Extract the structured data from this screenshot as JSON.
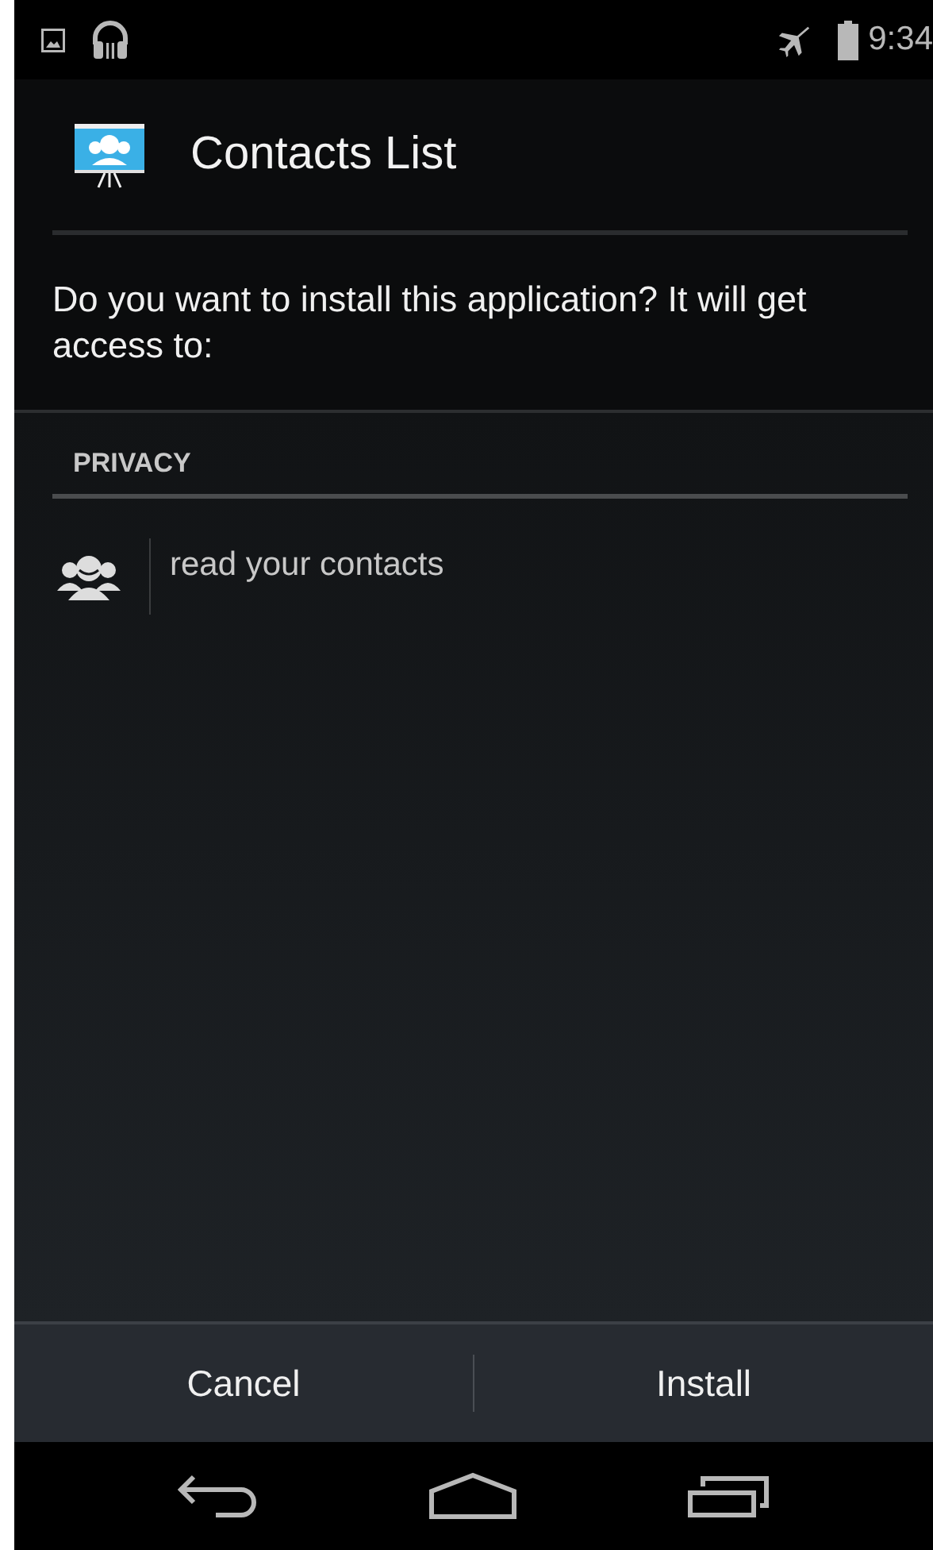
{
  "status_bar": {
    "time": "9:34"
  },
  "app": {
    "title": "Contacts List"
  },
  "prompt": "Do you want to install this application? It will get access to:",
  "sections": [
    {
      "heading": "PRIVACY",
      "permissions": [
        {
          "kind": "contacts",
          "label": "read your contacts"
        }
      ]
    }
  ],
  "buttons": [
    {
      "label": "Cancel"
    },
    {
      "label": "Install"
    }
  ]
}
